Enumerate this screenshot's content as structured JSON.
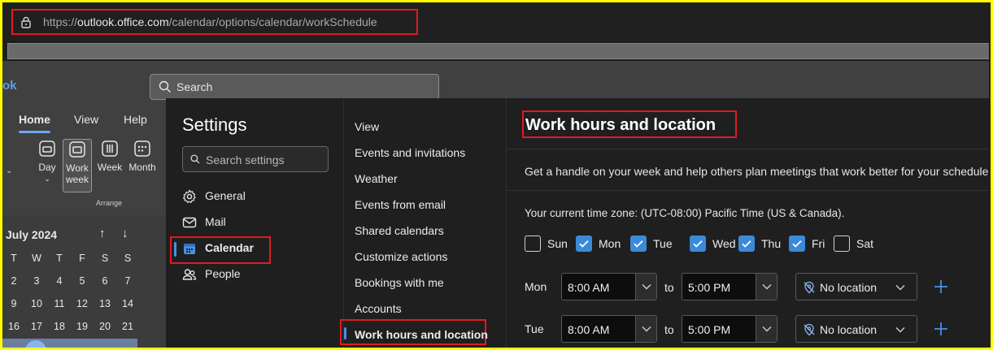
{
  "browser": {
    "url_prefix": "https://",
    "url_host": "outlook.office.com",
    "url_path": "/calendar/options/calendar/workSchedule"
  },
  "app": {
    "brand_fragment": "ok",
    "search_label": "Search",
    "ribbon_tabs": [
      "Home",
      "View",
      "Help"
    ],
    "ribbon_buttons": [
      {
        "label": "Day",
        "icon": "day-view-icon"
      },
      {
        "label": "Work week",
        "icon": "work-week-view-icon"
      },
      {
        "label": "Week",
        "icon": "week-view-icon"
      },
      {
        "label": "Month",
        "icon": "month-view-icon"
      }
    ],
    "ribbon_group_label": "Arrange",
    "calendar": {
      "month_title": "July 2024",
      "weekday_headers": [
        "T",
        "W",
        "T",
        "F",
        "S",
        "S"
      ],
      "rows": [
        [
          "2",
          "3",
          "4",
          "5",
          "6",
          "7"
        ],
        [
          "9",
          "10",
          "11",
          "12",
          "13",
          "14"
        ],
        [
          "16",
          "17",
          "18",
          "19",
          "20",
          "21"
        ]
      ]
    }
  },
  "settings": {
    "title": "Settings",
    "search_placeholder": "Search settings",
    "categories": [
      {
        "label": "General",
        "icon": "gear-icon"
      },
      {
        "label": "Mail",
        "icon": "mail-icon"
      },
      {
        "label": "Calendar",
        "icon": "calendar-icon",
        "selected": true
      },
      {
        "label": "People",
        "icon": "people-icon"
      }
    ],
    "subcategories": [
      "View",
      "Events and invitations",
      "Weather",
      "Events from email",
      "Shared calendars",
      "Customize actions",
      "Bookings with me",
      "Accounts",
      "Work hours and location"
    ],
    "selected_subcategory": "Work hours and location"
  },
  "content": {
    "title": "Work hours and location",
    "description": "Get a handle on your week and help others plan meetings that work better for your schedule",
    "timezone": "Your current time zone: (UTC-08:00) Pacific Time (US & Canada).",
    "days": [
      {
        "label": "Sun",
        "checked": false
      },
      {
        "label": "Mon",
        "checked": true
      },
      {
        "label": "Tue",
        "checked": true
      },
      {
        "label": "Wed",
        "checked": true
      },
      {
        "label": "Thu",
        "checked": true
      },
      {
        "label": "Fri",
        "checked": true
      },
      {
        "label": "Sat",
        "checked": false
      }
    ],
    "to_label": "to",
    "schedule": [
      {
        "day": "Mon",
        "start": "8:00 AM",
        "end": "5:00 PM",
        "location": "No location"
      },
      {
        "day": "Tue",
        "start": "8:00 AM",
        "end": "5:00 PM",
        "location": "No location"
      }
    ]
  },
  "colors": {
    "accent": "#3b8ad8",
    "highlight_border": "#e01a22",
    "frame_border": "#ffff00",
    "background": "#1f1f1f"
  }
}
